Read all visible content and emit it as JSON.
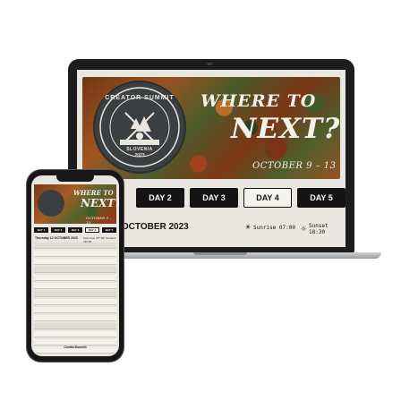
{
  "event": {
    "badge_title": "CREATOR SUMMIT",
    "badge_country": "SLOVENIA",
    "badge_year": "2023",
    "headline_top": "WHERE TO",
    "headline_main": "NEXT?",
    "dates": "OCTOBER 9 – 13"
  },
  "days": [
    {
      "label": "DAY 2",
      "active": false
    },
    {
      "label": "DAY 3",
      "active": false
    },
    {
      "label": "DAY 4",
      "active": true
    },
    {
      "label": "DAY 5",
      "active": false
    }
  ],
  "phone_days": [
    {
      "label": "DAY 1",
      "active": false
    },
    {
      "label": "DAY 2",
      "active": false
    },
    {
      "label": "DAY 3",
      "active": false
    },
    {
      "label": "DAY 4",
      "active": true
    },
    {
      "label": "DAY 5",
      "active": false
    }
  ],
  "schedule": {
    "date_heading": "12 OCTOBER 2023",
    "sunrise_label": "Sunrise 07:00",
    "sunset_label": "Sunset 18:30"
  },
  "phone": {
    "date_heading": "Thursday 12 OCTOBER 2023",
    "sun_text": "Sunrise 07:00   Sunset 18:30",
    "footer": "CreatorSummit"
  },
  "colors": {
    "button_dark": "#141414",
    "button_active": "#f4f3ee",
    "screen_bg": "#e9e7e0",
    "badge_bg": "#3c3f42"
  }
}
